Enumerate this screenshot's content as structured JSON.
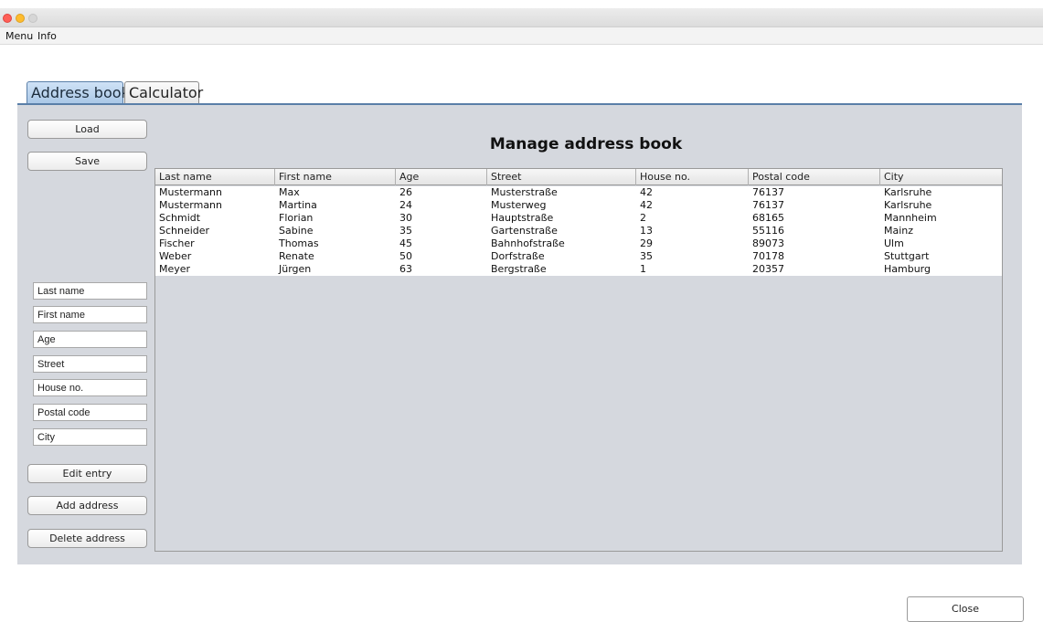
{
  "menubar": {
    "menu_label": "Menu",
    "info_label": "Info"
  },
  "tabs": [
    {
      "label": "Address book"
    },
    {
      "label": "Calculator"
    }
  ],
  "sidebar": {
    "load_label": "Load",
    "save_label": "Save",
    "fields": [
      {
        "placeholder": "Last name"
      },
      {
        "placeholder": "First name"
      },
      {
        "placeholder": "Age"
      },
      {
        "placeholder": "Street"
      },
      {
        "placeholder": "House no."
      },
      {
        "placeholder": "Postal code"
      },
      {
        "placeholder": "City"
      }
    ],
    "edit_label": "Edit entry",
    "add_label": "Add address",
    "delete_label": "Delete address"
  },
  "main": {
    "heading": "Manage address book",
    "columns": [
      "Last name",
      "First name",
      "Age",
      "Street",
      "House no.",
      "Postal code",
      "City"
    ],
    "rows": [
      [
        "Mustermann",
        "Max",
        "26",
        "Musterstraße",
        "42",
        "76137",
        "Karlsruhe"
      ],
      [
        "Mustermann",
        "Martina",
        "24",
        "Musterweg",
        "42",
        "76137",
        "Karlsruhe"
      ],
      [
        "Schmidt",
        "Florian",
        "30",
        "Hauptstraße",
        "2",
        "68165",
        "Mannheim"
      ],
      [
        "Schneider",
        "Sabine",
        "35",
        "Gartenstraße",
        "13",
        "55116",
        "Mainz"
      ],
      [
        "Fischer",
        "Thomas",
        "45",
        "Bahnhofstraße",
        "29",
        "89073",
        "Ulm"
      ],
      [
        "Weber",
        "Renate",
        "50",
        "Dorfstraße",
        "35",
        "70178",
        "Stuttgart"
      ],
      [
        "Meyer",
        "Jürgen",
        "63",
        "Bergstraße",
        "1",
        "20357",
        "Hamburg"
      ]
    ]
  },
  "footer": {
    "close_label": "Close"
  }
}
